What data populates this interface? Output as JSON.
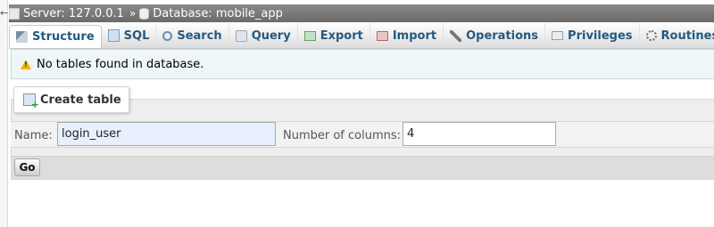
{
  "breadcrumb": {
    "server": "Server: 127.0.0.1",
    "separator": "»",
    "database": "Database: mobile_app"
  },
  "tabs": [
    {
      "label": "Structure",
      "icon": "structure-icon",
      "active": true
    },
    {
      "label": "SQL",
      "icon": "sql-icon",
      "active": false
    },
    {
      "label": "Search",
      "icon": "search-icon",
      "active": false
    },
    {
      "label": "Query",
      "icon": "query-icon",
      "active": false
    },
    {
      "label": "Export",
      "icon": "export-icon",
      "active": false
    },
    {
      "label": "Import",
      "icon": "import-icon",
      "active": false
    },
    {
      "label": "Operations",
      "icon": "wrench-icon",
      "active": false
    },
    {
      "label": "Privileges",
      "icon": "privileges-icon",
      "active": false
    },
    {
      "label": "Routines",
      "icon": "routines-icon",
      "active": false
    }
  ],
  "notice": {
    "text": "No tables found in database.",
    "icon": "warning-icon"
  },
  "create_table": {
    "legend": "Create table",
    "name_label": "Name:",
    "name_value": "login_user",
    "columns_label": "Number of columns:",
    "columns_value": "4",
    "go_label": "Go"
  },
  "colors": {
    "tab_text": "#235a81",
    "notice_bg": "#eef6f8",
    "input_autofill_bg": "#e8f0fe"
  }
}
